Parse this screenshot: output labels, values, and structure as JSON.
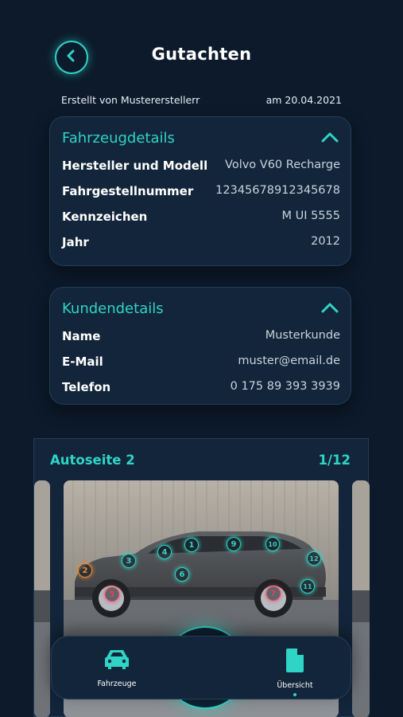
{
  "header": {
    "title": "Gutachten",
    "created_by": "Erstellt von Mustererstellerr",
    "created_at": "am 20.04.2021"
  },
  "vehicle_card": {
    "title": "Fahrzeugdetails",
    "rows": [
      {
        "label": "Hersteller und Modell",
        "value": "Volvo V60 Recharge"
      },
      {
        "label": "Fahrgestellnummer",
        "value": "12345678912345678"
      },
      {
        "label": "Kennzeichen",
        "value": "M UI 5555"
      },
      {
        "label": "Jahr",
        "value": "2012"
      }
    ]
  },
  "customer_card": {
    "title": "Kundendetails",
    "rows": [
      {
        "label": "Name",
        "value": "Musterkunde"
      },
      {
        "label": "E-Mail",
        "value": "muster@email.de"
      },
      {
        "label": "Telefon",
        "value": "0 175 89 393 3939"
      }
    ]
  },
  "gallery": {
    "title": "Autoseite 2",
    "page": "1/12",
    "markers": [
      {
        "n": "1",
        "color": "#2fd4c6"
      },
      {
        "n": "2",
        "color": "#f08a2c"
      },
      {
        "n": "3",
        "color": "#2fd4c6"
      },
      {
        "n": "4",
        "color": "#2fd4c6"
      },
      {
        "n": "5",
        "color": "#e0435b"
      },
      {
        "n": "6",
        "color": "#2fd4c6"
      },
      {
        "n": "7",
        "color": "#e0435b"
      },
      {
        "n": "9",
        "color": "#2fd4c6"
      },
      {
        "n": "10",
        "color": "#2fd4c6"
      },
      {
        "n": "11",
        "color": "#2fd4c6"
      },
      {
        "n": "12",
        "color": "#2fd4c6"
      }
    ]
  },
  "bottom_nav": {
    "left_label": "Fahrzeuge",
    "right_label": "Übersicht"
  },
  "icons": {
    "back": "chevron-left-icon",
    "collapse": "chevron-up-icon",
    "vehicles": "car-icon",
    "camera": "camera-icon",
    "overview": "document-icon"
  },
  "colors": {
    "accent": "#2fd4c6",
    "background": "#0d1a2b",
    "card": "#13253a"
  }
}
